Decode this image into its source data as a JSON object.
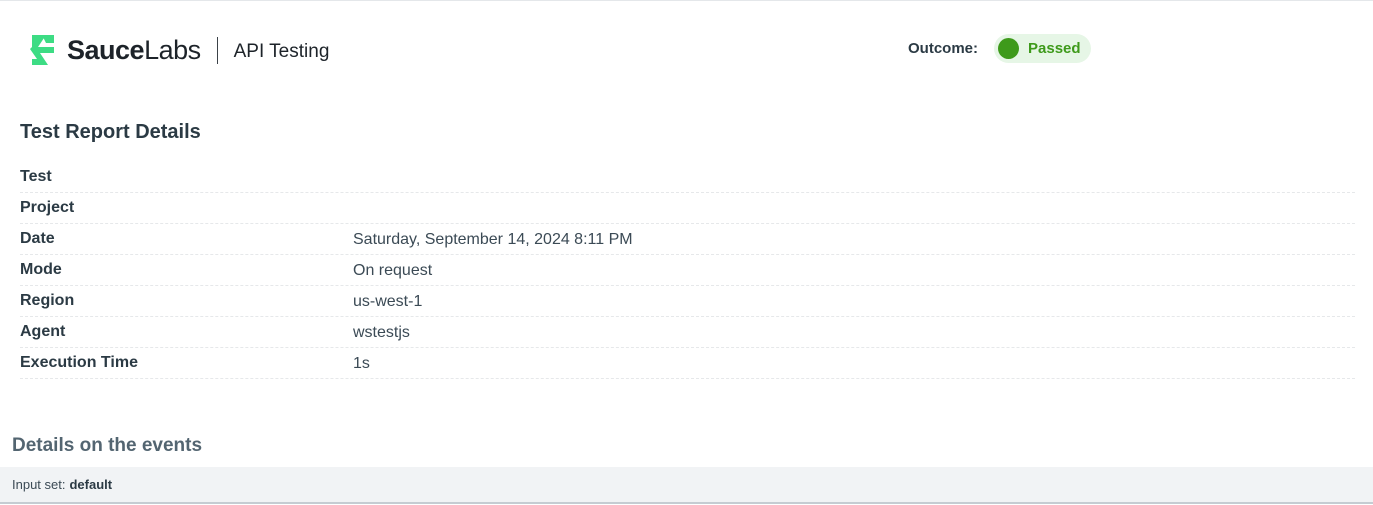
{
  "header": {
    "brand_bold": "Sauce",
    "brand_light": "Labs",
    "product": "API Testing",
    "outcome_label": "Outcome:",
    "outcome_status": "Passed"
  },
  "details": {
    "title": "Test Report Details",
    "rows": [
      {
        "label": "Test",
        "value": ""
      },
      {
        "label": "Project",
        "value": ""
      },
      {
        "label": "Date",
        "value": "Saturday, September 14, 2024 8:11 PM"
      },
      {
        "label": "Mode",
        "value": "On request"
      },
      {
        "label": "Region",
        "value": "us-west-1"
      },
      {
        "label": "Agent",
        "value": "wstestjs"
      },
      {
        "label": "Execution Time",
        "value": "1s"
      }
    ]
  },
  "events": {
    "title": "Details on the events",
    "input_set_label": "Input set:",
    "input_set_value": "default"
  },
  "colors": {
    "brand_green": "#3ddc84",
    "passed_green": "#3e9a1b",
    "passed_bg": "#e6f6e6"
  },
  "icons": {
    "logo": "saucelabs-logo-icon",
    "status": "status-dot-icon"
  }
}
